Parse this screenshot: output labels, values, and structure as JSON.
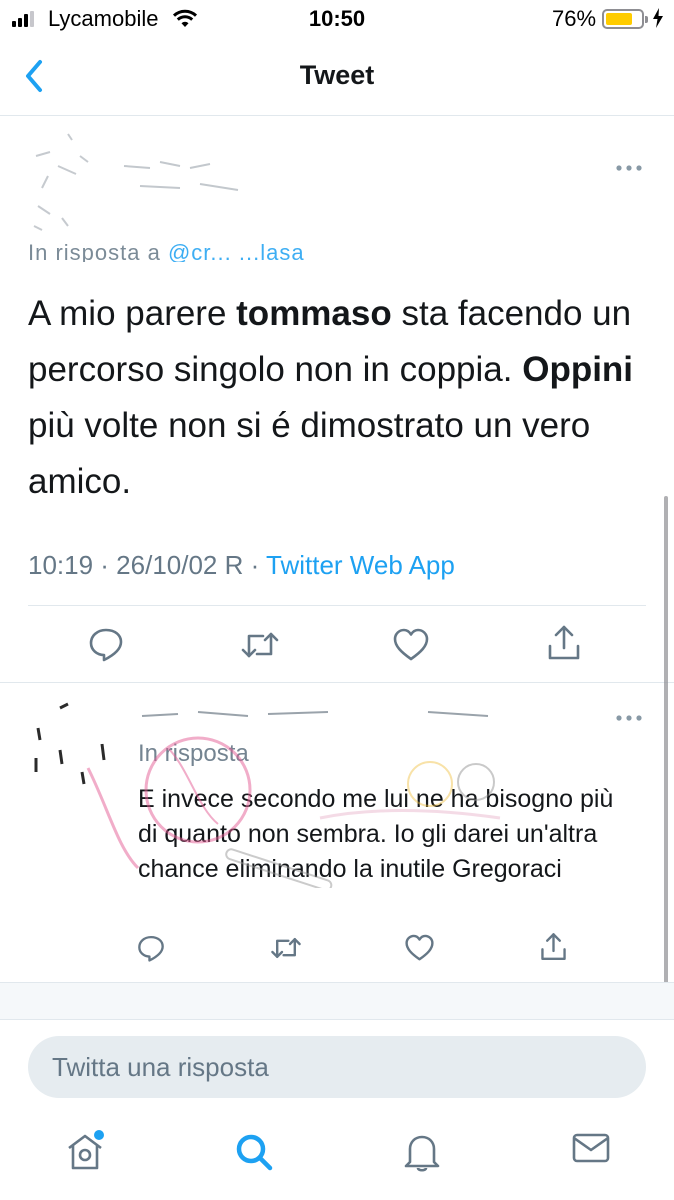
{
  "status_bar": {
    "carrier": "Lycamobile",
    "time": "10:50",
    "battery_percent": "76%",
    "battery_level": 0.76,
    "battery_color": "#ffcc00"
  },
  "nav": {
    "title": "Tweet",
    "back_icon": "chevron-left-icon"
  },
  "tweet": {
    "reply_prefix": "In risposta a",
    "reply_handle": "@cr... ...lasa",
    "text_parts": [
      {
        "t": "A mio parere ",
        "bold": false
      },
      {
        "t": "tommaso",
        "bold": true
      },
      {
        "t": " sta facendo un percorso singolo non in coppia. ",
        "bold": false
      },
      {
        "t": "Oppini",
        "bold": true
      },
      {
        "t": " più volte non si é dimostrato un vero amico.",
        "bold": false
      }
    ],
    "timestamp": "10:19 · 26/10/02 R · ",
    "source": "Twitter Web App"
  },
  "reply": {
    "reply_to_label": "In risposta",
    "text": "E invece secondo me lui ne ha bisogno più di quanto non sembra. Io gli darei un'altra chance eliminando la inutile Gregoraci"
  },
  "compose": {
    "placeholder": "Twitta una risposta"
  },
  "tabs": [
    "home-icon",
    "search-icon",
    "notifications-icon",
    "messages-icon"
  ],
  "colors": {
    "accent": "#1da1f2",
    "text": "#14171a",
    "secondary": "#657786"
  }
}
